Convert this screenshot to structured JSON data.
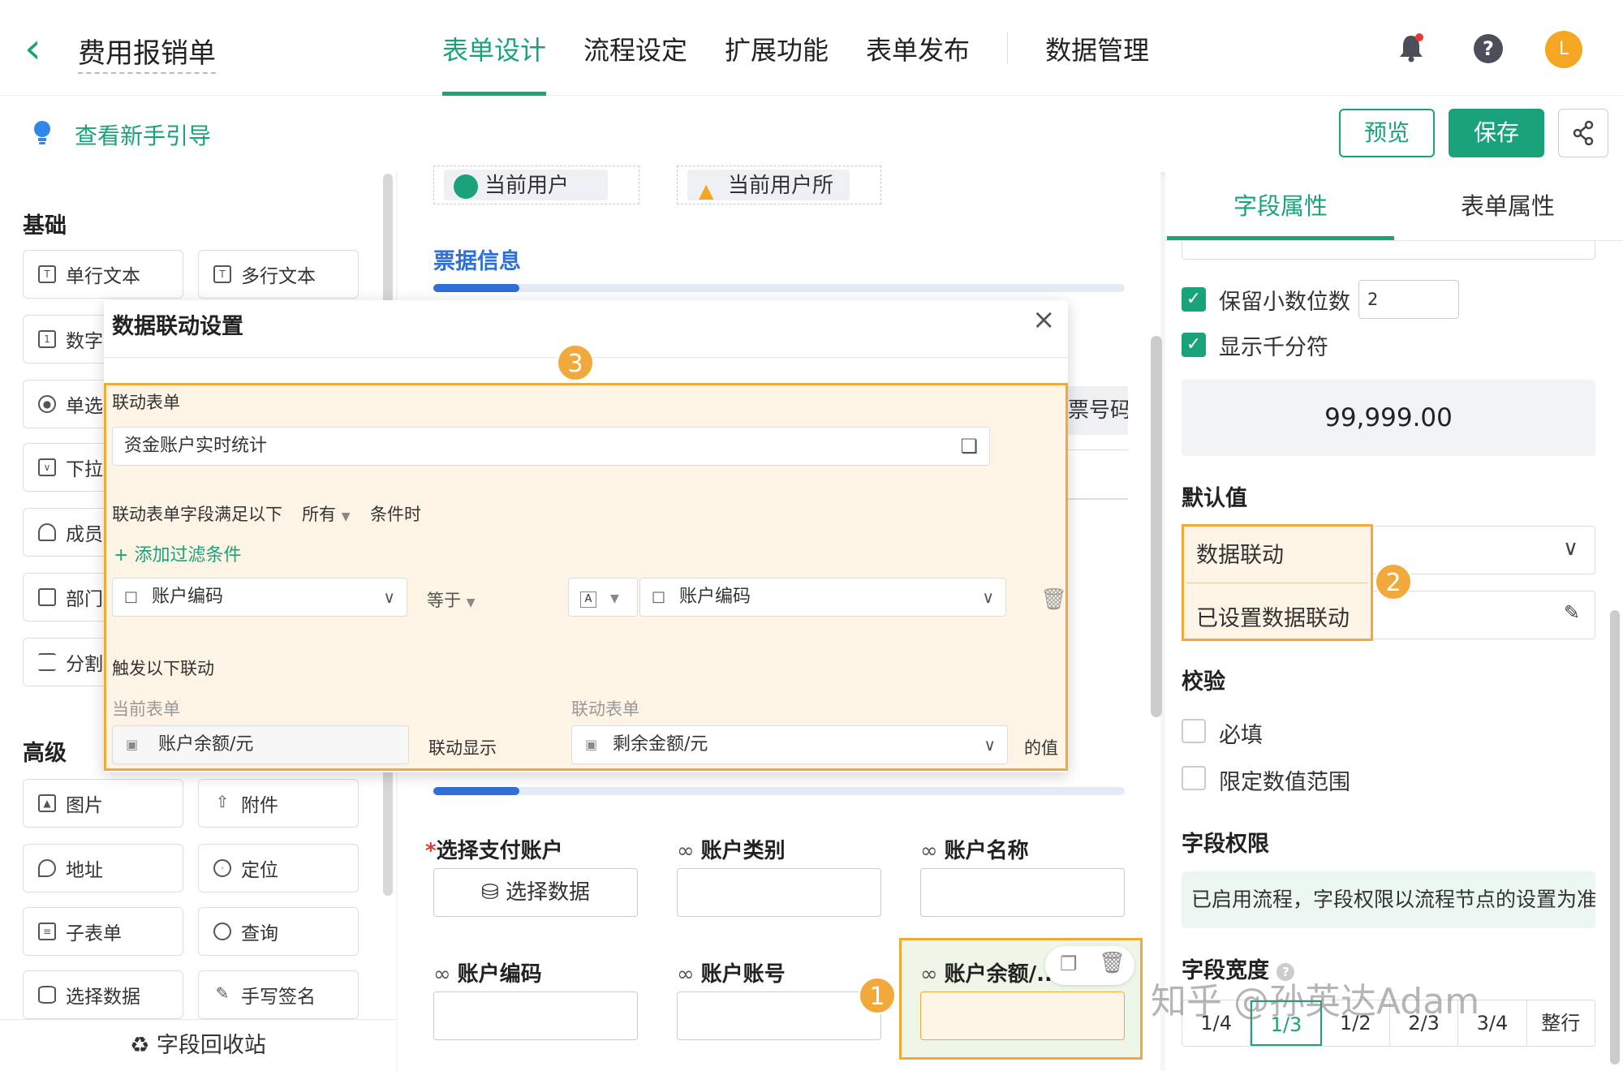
{
  "header": {
    "back_icon": "chevron-left-icon",
    "title": "费用报销单",
    "tabs": [
      "表单设计",
      "流程设定",
      "扩展功能",
      "表单发布",
      "数据管理"
    ],
    "active_tab": "表单设计",
    "avatar_letter": "L"
  },
  "subbar": {
    "guide": "查看新手引导",
    "preview": "预览",
    "save": "保存"
  },
  "left": {
    "basic_title": "基础",
    "basic_items": [
      "单行文本",
      "多行文本",
      "数字",
      "单选",
      "下拉",
      "成员",
      "部门",
      "分割"
    ],
    "advanced_title": "高级",
    "advanced_items": [
      "图片",
      "附件",
      "地址",
      "定位",
      "子表单",
      "查询",
      "选择数据",
      "手写签名"
    ],
    "recycle": "字段回收站"
  },
  "canvas": {
    "chip_user": "当前用户",
    "chip_dept": "当前用户所",
    "section": "票据信息",
    "partial_label": "票号码",
    "fields": {
      "pay_account": "选择支付账户",
      "select_data": "选择数据",
      "account_type": "账户类别",
      "account_name": "账户名称",
      "account_code": "账户编码",
      "account_no": "账户账号",
      "account_balance": "账户余额/..."
    }
  },
  "modal": {
    "title": "数据联动设置",
    "linked_form_label": "联动表单",
    "linked_form_value": "资金账户实时统计",
    "cond_prefix": "联动表单字段满足以下",
    "cond_mode": "所有",
    "cond_suffix": "条件时",
    "add_filter": "添加过滤条件",
    "filter_field": "账户编码",
    "filter_op": "等于",
    "filter_type": "A",
    "filter_value": "账户编码",
    "trigger_label": "触发以下联动",
    "current_form_label": "当前表单",
    "linked_form_label2": "联动表单",
    "current_field": "账户余额/元",
    "link_show": "联动显示",
    "linked_field": "剩余金额/元",
    "value_suffix": "的值"
  },
  "badges": {
    "one": "1",
    "two": "2",
    "three": "3"
  },
  "right": {
    "tabs": [
      "字段属性",
      "表单属性"
    ],
    "keep_decimal": "保留小数位数",
    "decimal_value": "2",
    "thousands": "显示千分符",
    "preview_value": "99,999.00",
    "default_title": "默认值",
    "default_mode": "数据联动",
    "linkage_set": "已设置数据联动",
    "validate_title": "校验",
    "required": "必填",
    "limit_range": "限定数值范围",
    "perm_title": "字段权限",
    "perm_note": "已启用流程，字段权限以流程节点的设置为准",
    "width_title": "字段宽度",
    "widths": [
      "1/4",
      "1/3",
      "1/2",
      "2/3",
      "3/4",
      "整行"
    ],
    "active_width": "1/3"
  },
  "watermark": "知乎 @孙英达Adam",
  "colors": {
    "accent": "#1aa37a",
    "highlight": "#f2a93b",
    "section_blue": "#2f6fd6"
  }
}
